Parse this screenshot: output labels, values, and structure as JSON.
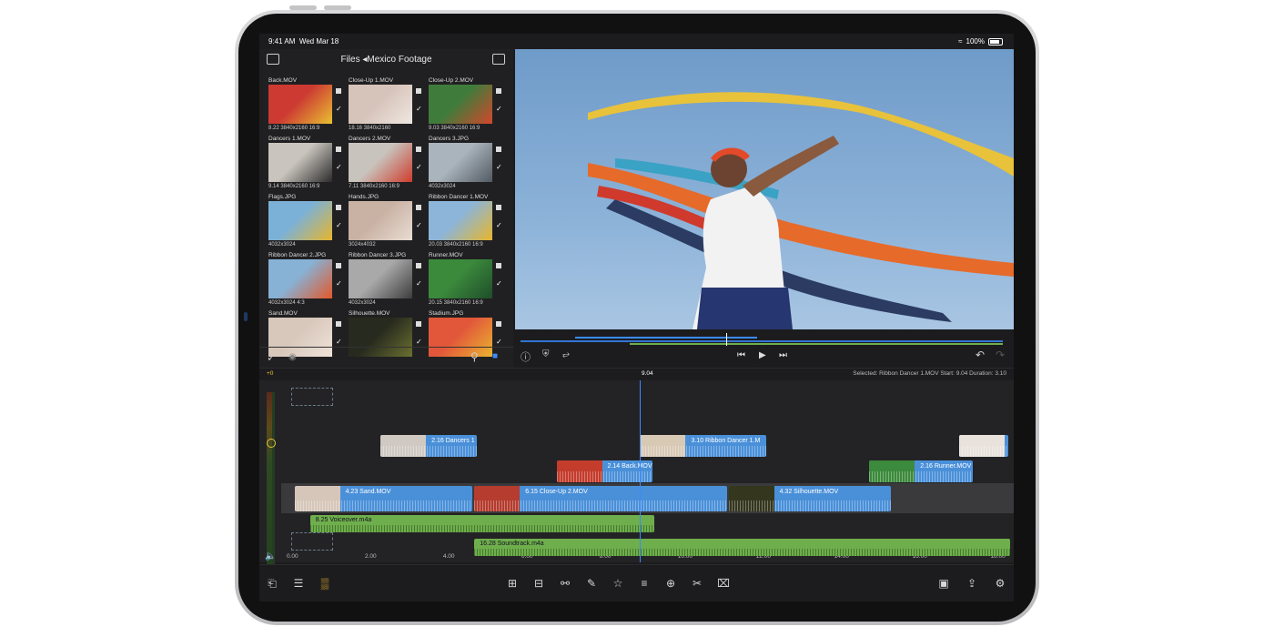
{
  "status": {
    "time": "9:41 AM",
    "date": "Wed Mar 18",
    "battery": "100%"
  },
  "browser": {
    "title": "Files ◂Mexico Footage",
    "clips": [
      {
        "name": "Back.MOV",
        "meta": "8.22  3840x2160  16:9",
        "colors": [
          "#cc3a32",
          "#e9c032"
        ]
      },
      {
        "name": "Close-Up 1.MOV",
        "meta": "18.16  3840x2160",
        "colors": [
          "#d6c3b9",
          "#efe7e2"
        ]
      },
      {
        "name": "Close-Up 2.MOV",
        "meta": "9.03  3840x2160  16:9",
        "colors": [
          "#3f7c3b",
          "#d2472c"
        ]
      },
      {
        "name": "Dancers 1.MOV",
        "meta": "9.14  3840x2160  16:9",
        "colors": [
          "#c9c4bd",
          "#2b2b2b"
        ]
      },
      {
        "name": "Dancers 2.MOV",
        "meta": "7.11  3840x2160  16:9",
        "colors": [
          "#c8c4bd",
          "#cf3c2d"
        ]
      },
      {
        "name": "Dancers 3.JPG",
        "meta": "4032x3024",
        "colors": [
          "#a9b4bd",
          "#525a63"
        ]
      },
      {
        "name": "Flags.JPG",
        "meta": "4032x3024",
        "colors": [
          "#7cb1d7",
          "#e7b62c"
        ]
      },
      {
        "name": "Hands.JPG",
        "meta": "3024x4032",
        "colors": [
          "#c9b2a4",
          "#e9dcd2"
        ]
      },
      {
        "name": "Ribbon Dancer 1.MOV",
        "meta": "20.03  3840x2160  16:9",
        "colors": [
          "#8cb5d9",
          "#e7b62c"
        ]
      },
      {
        "name": "Ribbon Dancer 2.JPG",
        "meta": "4032x3024  4:3",
        "colors": [
          "#87b2d6",
          "#e3582b"
        ]
      },
      {
        "name": "Ribbon Dancer 3.JPG",
        "meta": "4032x3024",
        "colors": [
          "#a9a9a9",
          "#3d3d3d"
        ]
      },
      {
        "name": "Runner.MOV",
        "meta": "20.15  3840x2160  16:9",
        "colors": [
          "#3b8a3c",
          "#1f4d2a"
        ]
      },
      {
        "name": "Sand.MOV",
        "meta": "",
        "colors": [
          "#d8c7bb",
          "#efe3d9"
        ]
      },
      {
        "name": "Silhouette.MOV",
        "meta": "",
        "colors": [
          "#272a1e",
          "#6b7030"
        ]
      },
      {
        "name": "Stadium.JPG",
        "meta": "",
        "colors": [
          "#e2573a",
          "#e9b430"
        ]
      }
    ]
  },
  "inspector": {
    "selected": "Selected: Ribbon Dancer 1.MOV  Start: 9.04  Duration: 3.10",
    "playhead_time": "9.04",
    "level": "+0"
  },
  "timeline": {
    "duration": 18.5,
    "playhead": 9.04,
    "ruler": [
      "0.00",
      "2.00",
      "4.00",
      "6.00",
      "8.00",
      "10.00",
      "12.00",
      "14.00",
      "16.00",
      "18.00"
    ],
    "clips": [
      {
        "label": "2.16  Dancers 1",
        "start": 2.4,
        "end": 4.9,
        "track": 1,
        "thumb": "#cfc9c2"
      },
      {
        "label": "3.10  Ribbon Dancer 1.M",
        "start": 9.04,
        "end": 12.3,
        "track": 1,
        "thumb": "#d8c9b5"
      },
      {
        "label": "",
        "start": 17.2,
        "end": 18.5,
        "track": 1,
        "thumb": "#e9e2dc"
      },
      {
        "label": "2.14  Back.MOV",
        "start": 6.9,
        "end": 9.4,
        "track": 2,
        "thumb": "#c43c2c"
      },
      {
        "label": "2.16  Runner.MOV",
        "start": 14.9,
        "end": 17.6,
        "track": 2,
        "thumb": "#3c8a3b"
      },
      {
        "label": "4.23  Sand.MOV",
        "start": 0.2,
        "end": 4.8,
        "track": 3,
        "thumb": "#d6c6b9"
      },
      {
        "label": "6.15  Close-Up 2.MOV",
        "start": 4.8,
        "end": 11.3,
        "track": 3,
        "thumb": "#b53c2e"
      },
      {
        "label": "4.32  Silhouette.MOV",
        "start": 11.3,
        "end": 15.5,
        "track": 3,
        "thumb": "#34361e"
      }
    ],
    "audio": [
      {
        "label": "8.25  Voiceover.m4a",
        "start": 0.6,
        "end": 9.4,
        "track": 0
      },
      {
        "label": "16.28  Soundtrack.m4a",
        "start": 4.8,
        "end": 18.5,
        "track": 1
      }
    ]
  },
  "toolbar": {
    "left_icons": [
      "import-icon",
      "list-icon",
      "meter-icon"
    ],
    "center_icons": [
      "add-clip-icon",
      "split-view-icon",
      "link-icon",
      "pencil-icon",
      "favorite-icon",
      "title-icon",
      "add-icon",
      "scissors-icon",
      "trash-icon"
    ],
    "right_icons": [
      "layout-icon",
      "share-icon",
      "settings-icon"
    ]
  }
}
